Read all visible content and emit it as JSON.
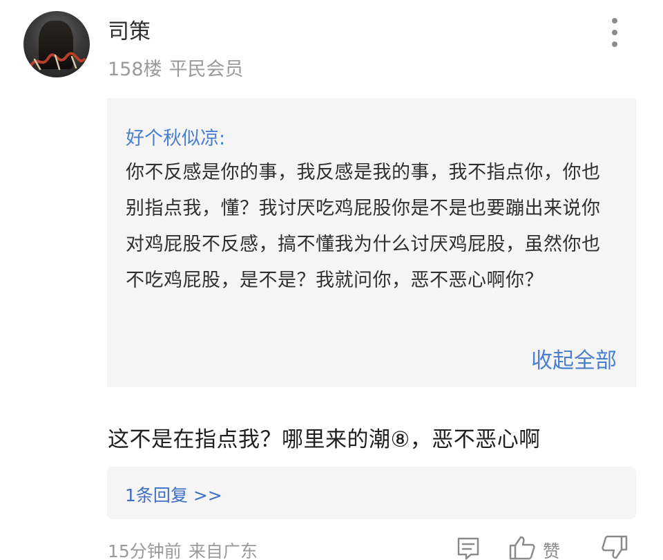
{
  "user": {
    "name": "司策",
    "floor": "158楼",
    "level": "平民会员"
  },
  "quote": {
    "author": "好个秋似凉:",
    "text": "你不反感是你的事，我反感是我的事，我不指点你，你也别指点我，懂？我讨厌吃鸡屁股你是不是也要蹦出来说你对鸡屁股不反感，搞不懂我为什么讨厌鸡屁股，虽然你也不吃鸡屁股，是不是？我就问你，恶不恶心啊你？",
    "collapse_label": "收起全部"
  },
  "comment": {
    "text": "这不是在指点我？哪里来的潮⑧，恶不恶心啊"
  },
  "replies": {
    "label": "1条回复 >>"
  },
  "footer": {
    "time": "15分钟前",
    "location": "来自广东",
    "like_label": "赞"
  },
  "icons": {
    "more": "more-vertical-icon",
    "reply": "comment-icon",
    "like": "thumbs-up-icon",
    "dislike": "thumbs-down-icon"
  },
  "colors": {
    "link": "#4a7fd0",
    "quote_bg": "#f5f5f5",
    "muted": "#9a9a9a"
  }
}
